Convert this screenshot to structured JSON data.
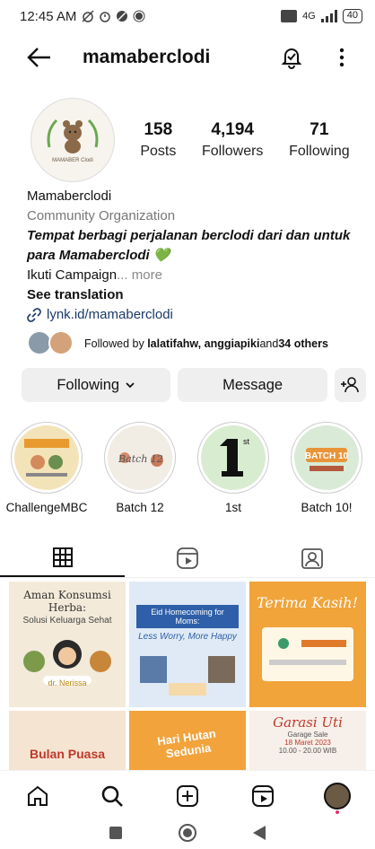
{
  "status_bar": {
    "time": "12:45 AM",
    "network": "4G",
    "battery": "40"
  },
  "header": {
    "username": "mamaberclodi"
  },
  "profile": {
    "avatar_text": "MAMABER Clodi",
    "stats": [
      {
        "value": "158",
        "label": "Posts"
      },
      {
        "value": "4,194",
        "label": "Followers"
      },
      {
        "value": "71",
        "label": "Following"
      }
    ]
  },
  "bio": {
    "name": "Mamaberclodi",
    "category": "Community Organization",
    "tagline": "Tempat berbagi perjalanan berclodi dari dan untuk para Mamaberclodi 💚",
    "campaign": "Ikuti Campaign",
    "more": "... more",
    "translation": "See translation",
    "link": "lynk.id/mamaberclodi"
  },
  "followed_by": {
    "prefix": "Followed by ",
    "names": "lalatifahw, anggiapiki",
    "middle": " and ",
    "others": "34 others"
  },
  "actions": {
    "following": "Following",
    "message": "Message"
  },
  "highlights": [
    {
      "label": "ChallengeMBC",
      "color": "#f3e3b8"
    },
    {
      "label": "Batch 12",
      "color": "#f1ece4"
    },
    {
      "label": "1st",
      "color": "#d8ecd0"
    },
    {
      "label": "Batch 10!",
      "color": "#d9ead7"
    }
  ],
  "posts": [
    {
      "title": "Aman Konsumsi Herba:",
      "subtitle": "Solusi Keluarga Sehat",
      "name": "dr. Nerissa",
      "bg": "#f3ead9"
    },
    {
      "title": "Eid Homecoming for Moms:",
      "subtitle": "Less Worry, More Happy",
      "bg": "#dfeaf6"
    },
    {
      "title": "Terima Kasih!",
      "bg": "#f0a43a"
    },
    {
      "title": "Bulan Puasa",
      "bg": "#f6e4d2"
    },
    {
      "title": "Hari Hutan Sedunia",
      "bg": "#f2a33b"
    },
    {
      "title": "Garasi Uti",
      "subtitle": "Garage Sale",
      "date": "18 Maret 2023",
      "time": "10.00 - 20.00 WIB",
      "bg": "#f7efe9"
    }
  ]
}
